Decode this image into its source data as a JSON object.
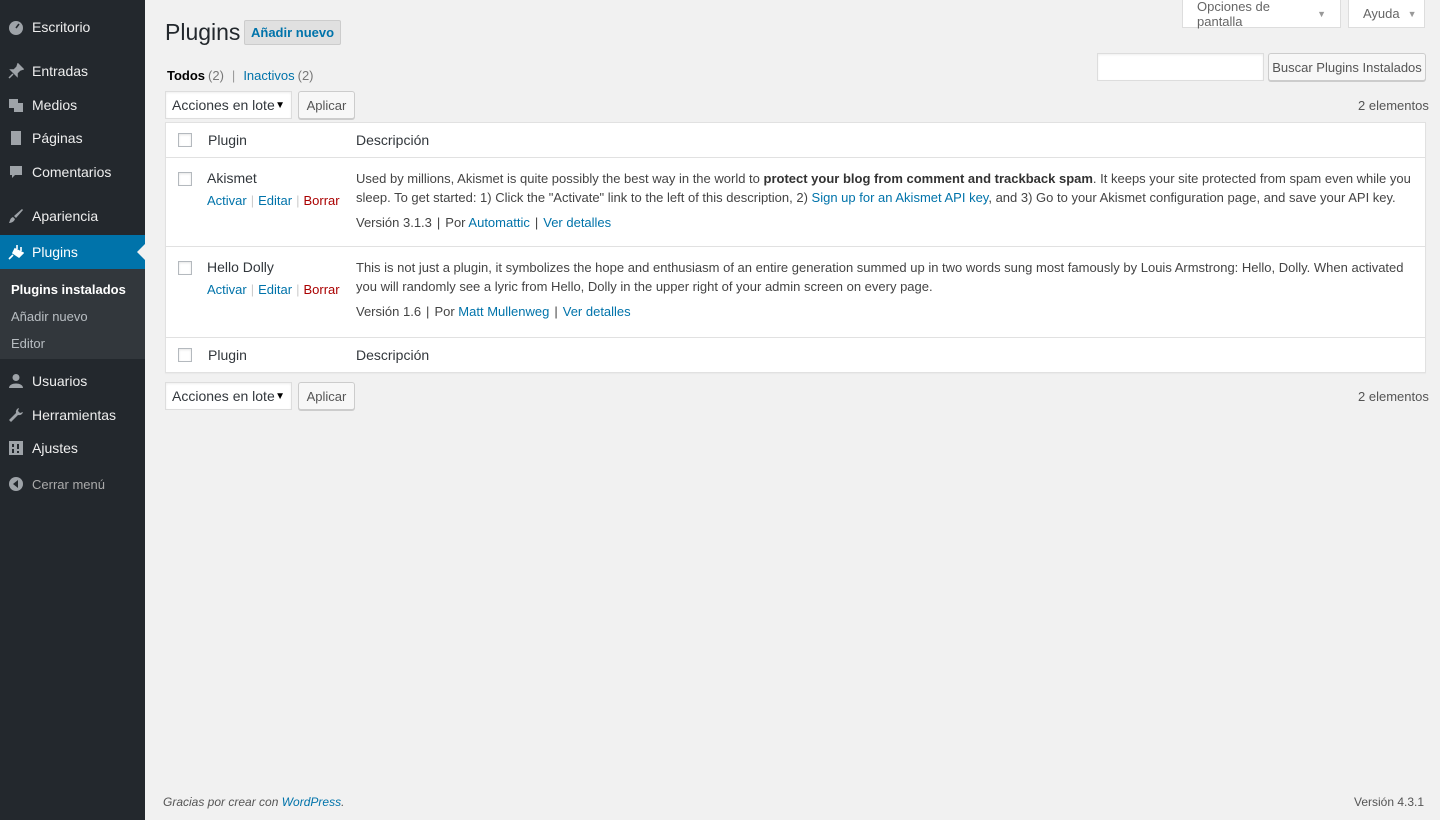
{
  "sidebar": {
    "items": [
      {
        "label": "Escritorio",
        "icon": "dashboard-icon"
      },
      {
        "label": "Entradas",
        "icon": "pin-icon"
      },
      {
        "label": "Medios",
        "icon": "media-icon"
      },
      {
        "label": "Páginas",
        "icon": "page-icon"
      },
      {
        "label": "Comentarios",
        "icon": "comment-icon"
      },
      {
        "label": "Apariencia",
        "icon": "brush-icon"
      },
      {
        "label": "Plugins",
        "icon": "plugin-icon"
      },
      {
        "label": "Usuarios",
        "icon": "user-icon"
      },
      {
        "label": "Herramientas",
        "icon": "wrench-icon"
      },
      {
        "label": "Ajustes",
        "icon": "settings-icon"
      }
    ],
    "submenu": [
      "Plugins instalados",
      "Añadir nuevo",
      "Editor"
    ],
    "collapse_label": "Cerrar menú"
  },
  "screen_options": {
    "label": "Opciones de pantalla",
    "help": "Ayuda"
  },
  "page": {
    "title": "Plugins",
    "add_new": "Añadir nuevo"
  },
  "filters": {
    "all_label": "Todos",
    "all_count": "(2)",
    "inactive_label": "Inactivos",
    "inactive_count": "(2)",
    "separator": "|"
  },
  "search": {
    "button": "Buscar Plugins Instalados",
    "value": ""
  },
  "bulk": {
    "select": "Acciones en lote",
    "apply": "Aplicar"
  },
  "items_count": "2 elementos",
  "table": {
    "columns": [
      "Plugin",
      "Descripción"
    ],
    "rows": [
      {
        "name": "Akismet",
        "actions": [
          "Activar",
          "Editar",
          "Borrar"
        ],
        "desc_1": "Used by millions, Akismet is quite possibly the best way in the world to ",
        "desc_bold": "protect your blog from comment and trackback spam",
        "desc_2": ". It keeps your site protected from spam even while you sleep. To get started: 1) Click the \"Activate\" link to the left of this description, 2) ",
        "desc_link": "Sign up for an Akismet API key",
        "desc_3": ", and 3) Go to your Akismet configuration page, and save your API key.",
        "version": "Versión 3.1.3",
        "by": "Por",
        "author": "Automattic",
        "details": "Ver detalles"
      },
      {
        "name": "Hello Dolly",
        "actions": [
          "Activar",
          "Editar",
          "Borrar"
        ],
        "desc": "This is not just a plugin, it symbolizes the hope and enthusiasm of an entire generation summed up in two words sung most famously by Louis Armstrong: Hello, Dolly. When activated you will randomly see a lyric from Hello, Dolly in the upper right of your admin screen on every page.",
        "version": "Versión 1.6",
        "by": "Por",
        "author": "Matt Mullenweg",
        "details": "Ver detalles"
      }
    ]
  },
  "footer": {
    "thanks": "Gracias por crear con ",
    "wordpress": "WordPress",
    "thanks_end": ".",
    "version": "Versión 4.3.1"
  }
}
